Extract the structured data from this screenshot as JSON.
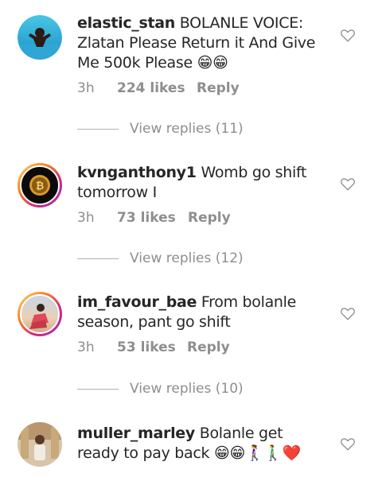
{
  "comments": [
    {
      "username": "elastic_stan",
      "text": "BOLANLE VOICE: Zlatan Please Return it And Give Me 500k Please 😁😁",
      "time": "3h",
      "likes": "224 likes",
      "reply": "Reply",
      "view_replies": "View replies (11)"
    },
    {
      "username": "kvnganthony1",
      "text": "Womb go shift tomorrow I",
      "time": "3h",
      "likes": "73 likes",
      "reply": "Reply",
      "view_replies": "View replies (12)"
    },
    {
      "username": "im_favour_bae",
      "text": "From bolanle season, pant go shift",
      "time": "3h",
      "likes": "53 likes",
      "reply": "Reply",
      "view_replies": "View replies (10)"
    },
    {
      "username": "muller_marley",
      "text": "Bolanle get ready to pay back 😁😁🚶‍♀️🚶‍♂️❤️",
      "time": "",
      "likes": "",
      "reply": "",
      "view_replies": ""
    }
  ],
  "colors": {
    "text": "#262626",
    "muted": "#8e8e8e",
    "ring_gradient": [
      "#feda75",
      "#fa7e1e",
      "#d62976",
      "#962fbf"
    ],
    "heart": "#8e8e8e"
  },
  "icons": {
    "like": "heart-outline-icon"
  }
}
